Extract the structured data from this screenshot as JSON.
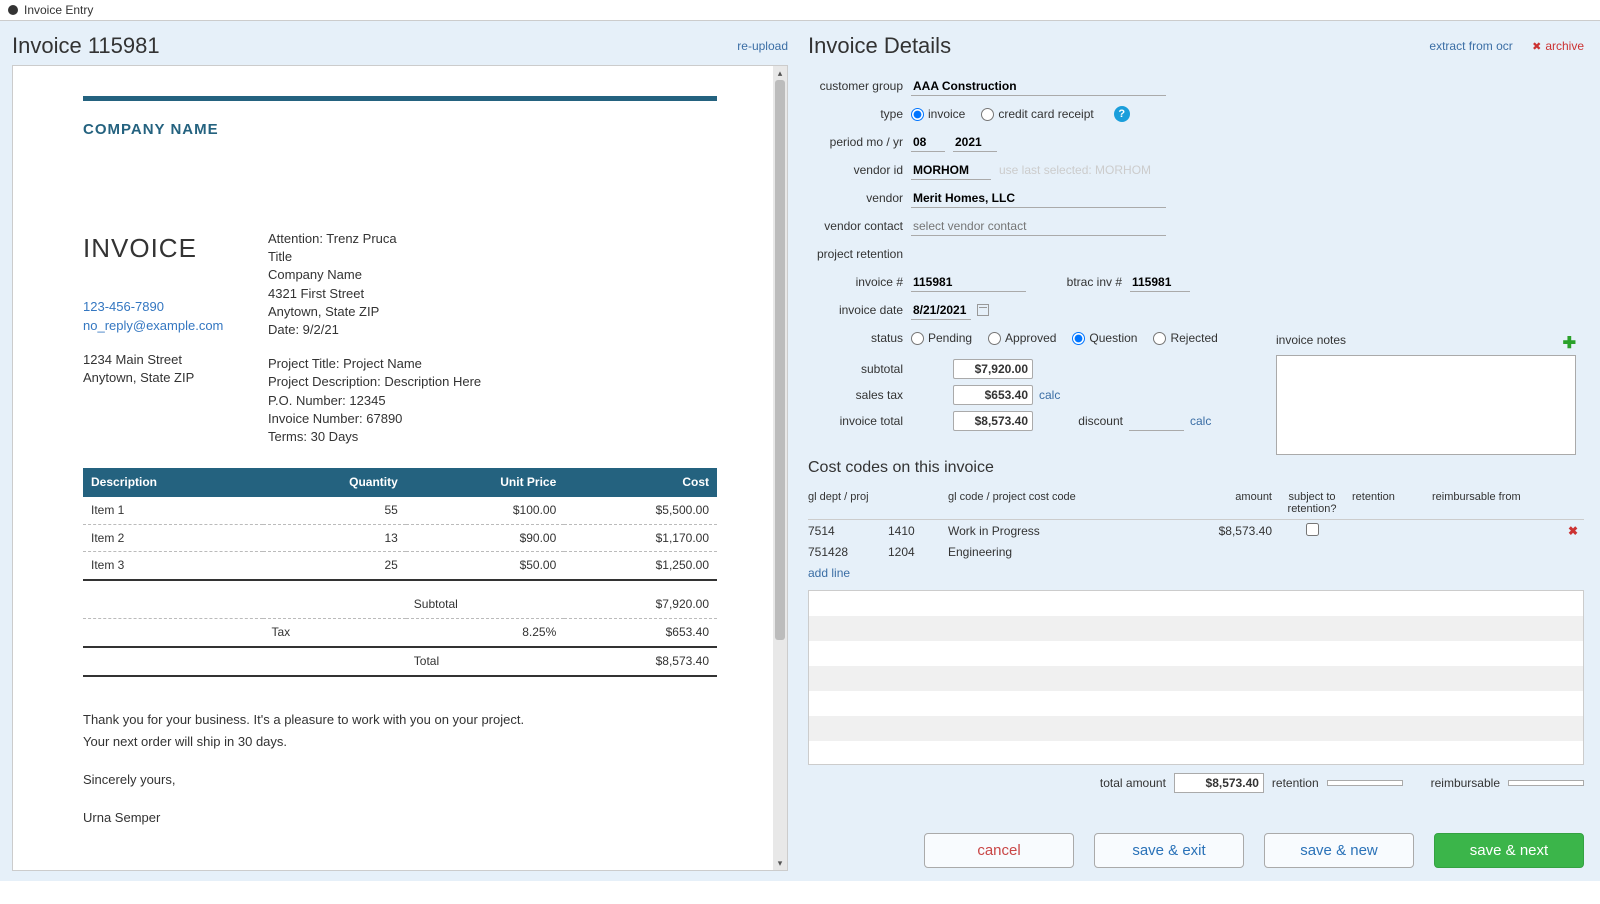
{
  "window": {
    "title": "Invoice Entry"
  },
  "left": {
    "title": "Invoice 115981",
    "reupload": "re-upload"
  },
  "doc": {
    "company_name": "COMPANY NAME",
    "heading": "INVOICE",
    "phone": "123-456-7890",
    "email": "no_reply@example.com",
    "addr1": "1234 Main Street",
    "addr2": "Anytown, State ZIP",
    "attn": "Attention: Trenz Pruca",
    "attn_title": "Title",
    "attn_company": "Company Name",
    "attn_addr1": "4321 First Street",
    "attn_addr2": "Anytown, State ZIP",
    "date": "Date: 9/2/21",
    "proj_title": "Project Title: Project Name",
    "proj_desc": "Project Description: Description Here",
    "po": "P.O. Number: 12345",
    "invno": "Invoice Number: 67890",
    "terms": "Terms: 30 Days",
    "cols": {
      "desc": "Description",
      "qty": "Quantity",
      "unit": "Unit Price",
      "cost": "Cost"
    },
    "items": [
      {
        "desc": "Item 1",
        "qty": "55",
        "unit": "$100.00",
        "cost": "$5,500.00"
      },
      {
        "desc": "Item 2",
        "qty": "13",
        "unit": "$90.00",
        "cost": "$1,170.00"
      },
      {
        "desc": "Item 3",
        "qty": "25",
        "unit": "$50.00",
        "cost": "$1,250.00"
      }
    ],
    "subtotal_lbl": "Subtotal",
    "subtotal": "$7,920.00",
    "tax_lbl": "Tax",
    "tax_rate": "8.25%",
    "tax": "$653.40",
    "total_lbl": "Total",
    "total": "$8,573.40",
    "closing1": "Thank you for your business. It's a pleasure to work with you on your project.",
    "closing2": "Your next order will ship in 30 days.",
    "signoff": "Sincerely yours,",
    "signer": "Urna Semper"
  },
  "details": {
    "title": "Invoice Details",
    "extract": "extract from ocr",
    "archive": "archive",
    "labels": {
      "customer_group": "customer group",
      "type": "type",
      "type_invoice": "invoice",
      "type_cc": "credit card receipt",
      "period": "period mo / yr",
      "vendor_id": "vendor id",
      "use_last": "use last selected: MORHOM",
      "vendor": "vendor",
      "vendor_contact": "vendor contact",
      "vendor_contact_ph": "select vendor contact",
      "project_retention": "project retention",
      "invoice_no": "invoice #",
      "btrac": "btrac inv #",
      "invoice_date": "invoice date",
      "status": "status",
      "pending": "Pending",
      "approved": "Approved",
      "question": "Question",
      "rejected": "Rejected",
      "subtotal": "subtotal",
      "sales_tax": "sales tax",
      "calc_tax": "calc",
      "invoice_total": "invoice total",
      "discount": "discount",
      "calc": "calc",
      "notes": "invoice notes"
    },
    "values": {
      "customer_group": "AAA Construction",
      "period_mo": "08",
      "period_yr": "2021",
      "vendor_id": "MORHOM",
      "vendor": "Merit Homes, LLC",
      "invoice_no": "115981",
      "btrac": "115981",
      "invoice_date": "8/21/2021",
      "subtotal": "$7,920.00",
      "sales_tax": "$653.40",
      "invoice_total": "$8,573.40"
    }
  },
  "cost": {
    "title": "Cost codes on this invoice",
    "cols": {
      "dept": "gl dept / proj",
      "gl": "gl code / project cost code",
      "amt": "amount",
      "ret": "subject to retention?",
      "rtn": "retention",
      "rmb": "reimbursable from"
    },
    "rows": [
      {
        "dept": "7514",
        "gl": "1410",
        "desc": "Work in Progress",
        "amt": "$8,573.40",
        "ret": false
      },
      {
        "dept": "751428",
        "gl": "1204",
        "desc": "Engineering",
        "amt": "",
        "ret": null
      }
    ],
    "add_line": "add line",
    "totals": {
      "amount_lbl": "total amount",
      "amount": "$8,573.40",
      "retention_lbl": "retention",
      "reimb_lbl": "reimbursable"
    }
  },
  "actions": {
    "cancel": "cancel",
    "save_exit": "save & exit",
    "save_new": "save & new",
    "save_next": "save & next"
  }
}
